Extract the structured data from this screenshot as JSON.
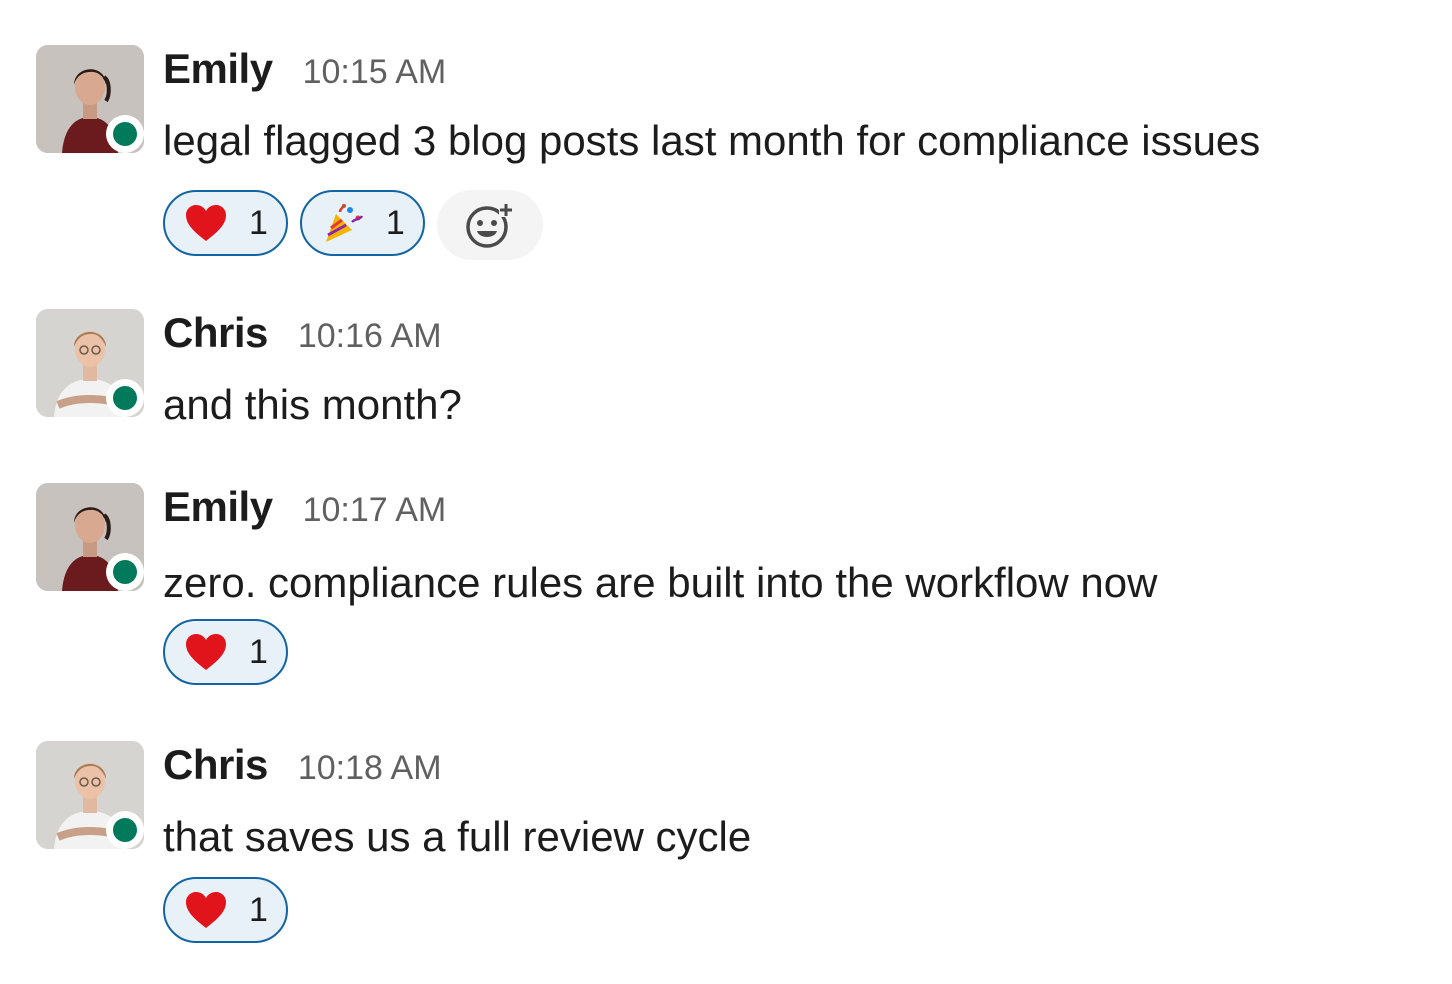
{
  "messages": [
    {
      "author": "Emily",
      "time": "10:15 AM",
      "text": "legal flagged 3 blog posts last month for compliance issues",
      "presence": "online",
      "reactions": [
        {
          "emoji": "heart-emoji",
          "count": "1"
        },
        {
          "emoji": "party-popper-emoji",
          "count": "1"
        }
      ],
      "has_add_reaction": true
    },
    {
      "author": "Chris",
      "time": "10:16 AM",
      "text": "and this month?",
      "presence": "online",
      "reactions": []
    },
    {
      "author": "Emily",
      "time": "10:17 AM",
      "text": "zero. compliance rules are built into the workflow now",
      "presence": "online",
      "reactions": [
        {
          "emoji": "heart-emoji",
          "count": "1"
        }
      ]
    },
    {
      "author": "Chris",
      "time": "10:18 AM",
      "text": "that saves us a full review cycle",
      "presence": "online",
      "reactions": [
        {
          "emoji": "heart-emoji",
          "count": "1"
        }
      ]
    }
  ],
  "colors": {
    "presence_online": "#007a5a",
    "reaction_border": "#1264a3",
    "reaction_bg": "#e8f0f8",
    "timestamp": "#616061"
  }
}
